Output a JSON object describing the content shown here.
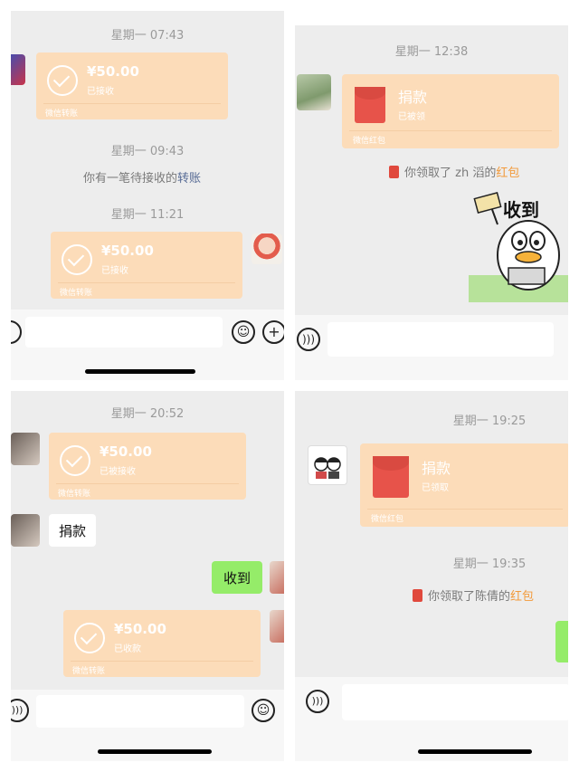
{
  "panels": {
    "top_left": {
      "time1": "星期一 07:43",
      "card1": {
        "amount": "¥50.00",
        "status": "已接收",
        "footer": "微信转账"
      },
      "time2": "星期一 09:43",
      "notice_prefix": "你有一笔待接收的",
      "notice_link": "转账",
      "time3": "星期一 11:21",
      "card2": {
        "amount": "¥50.00",
        "status": "已接收",
        "footer": "微信转账"
      }
    },
    "top_right": {
      "time1": "星期一 12:38",
      "redpacket": {
        "title": "捐款",
        "status": "已被领",
        "footer": "微信红包"
      },
      "note_prefix": "你领取了 zh 滔的",
      "note_highlight": "红包",
      "sticker_text": "收到"
    },
    "bottom_left": {
      "time1": "星期一 20:52",
      "card1": {
        "amount": "¥50.00",
        "status": "已被接收",
        "footer": "微信转账"
      },
      "bubble_in": "捐款",
      "bubble_out": "收到",
      "card2": {
        "amount": "¥50.00",
        "status": "已收款",
        "footer": "微信转账"
      }
    },
    "bottom_right": {
      "time1": "星期一 19:25",
      "redpacket": {
        "title": "捐款",
        "status": "已领取",
        "footer": "微信红包"
      },
      "time2": "星期一 19:35",
      "note_prefix": "你领取了陈倩的",
      "note_highlight": "红包"
    }
  },
  "colors": {
    "card_bg": "#fcdcb9",
    "chat_bg": "#ededed",
    "sent_bubble": "#95ec69",
    "red_packet": "#e7534a",
    "highlight": "#f29a3a"
  }
}
